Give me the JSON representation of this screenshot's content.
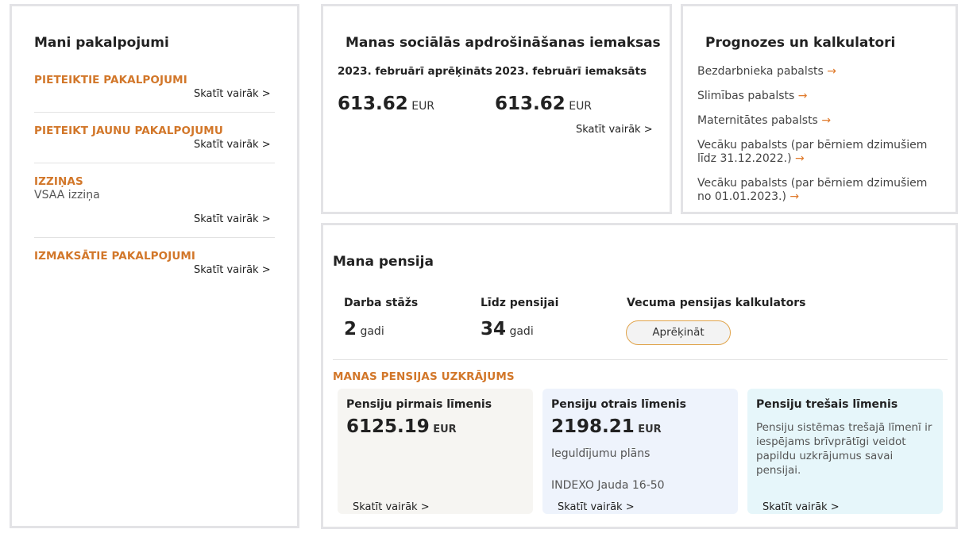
{
  "services": {
    "title": "Mani pakalpojumi",
    "sections": [
      {
        "heading": "PIETEIKTIE PAKALPOJUMI",
        "more": "Skatīt vairāk >"
      },
      {
        "heading": "PIETEIKT JAUNU PAKALPOJUMU",
        "more": "Skatīt vairāk >"
      },
      {
        "heading": "IZZIŅAS",
        "sub": "VSAA izziņa",
        "more": "Skatīt vairāk >"
      },
      {
        "heading": "IZMAKSĀTIE PAKALPOJUMI",
        "more": "Skatīt vairāk >"
      }
    ]
  },
  "social": {
    "title": "Manas sociālās apdrošināšanas iemaksas",
    "calculated_label": "2023. februārī aprēķināts",
    "calculated_value": "613.62",
    "paid_label": "2023. februārī iemaksāts",
    "paid_value": "613.62",
    "currency": "EUR",
    "more": "Skatīt vairāk >"
  },
  "calculators": {
    "title": "Prognozes un kalkulatori",
    "arrow": "→",
    "links": [
      {
        "line1": "Bezdarbnieka pabalsts"
      },
      {
        "line1": "Slimības pabalsts"
      },
      {
        "line1": "Maternitātes pabalsts"
      },
      {
        "line1": "Vecāku pabalsts (par bērniem dzimušiem",
        "line2": "līdz 31.12.2022.)"
      },
      {
        "line1": "Vecāku pabalsts (par bērniem dzimušiem",
        "line2": "no 01.01.2023.)"
      }
    ]
  },
  "pension": {
    "title": "Mana pensija",
    "work_label": "Darba stāžs",
    "work_value": "2",
    "work_unit": "gadi",
    "until_label": "Līdz pensijai",
    "until_value": "34",
    "until_unit": "gadi",
    "calc_label": "Vecuma pensijas kalkulators",
    "calc_button": "Aprēķināt",
    "savings_heading": "MANAS PENSIJAS UZKRĀJUMS",
    "tiers": [
      {
        "title": "Pensiju pirmais līmenis",
        "value": "6125.19",
        "currency": "EUR",
        "more": "Skatīt vairāk >",
        "bg": "#f6f5f2"
      },
      {
        "title": "Pensiju otrais līmenis",
        "value": "2198.21",
        "currency": "EUR",
        "plan_label": "Ieguldījumu plāns",
        "plan_name": "INDEXO Jauda 16-50",
        "more": "Skatīt vairāk >",
        "bg": "#eef3fc"
      },
      {
        "title": "Pensiju trešais līmenis",
        "text": "Pensiju sistēmas trešajā līmenī ir iespējams brīvprātīgi veidot papildu uzkrājumus savai pensijai.",
        "more": "Skatīt vairāk >",
        "bg": "#e6f6fa"
      }
    ]
  },
  "colors": {
    "accent": "#d2772a",
    "border": "#e3e3e6"
  }
}
